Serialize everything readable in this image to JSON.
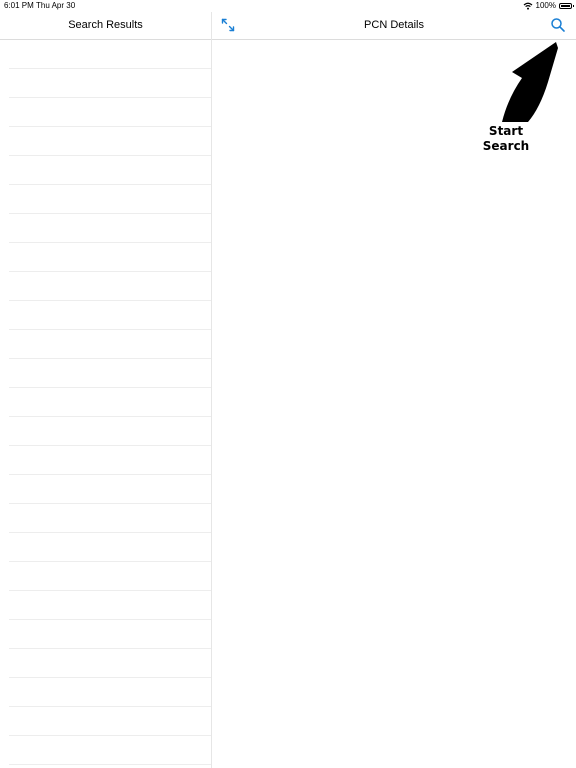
{
  "status_bar": {
    "time": "6:01 PM",
    "date": "Thu Apr 30",
    "battery": "100%",
    "battery_level": 1.0
  },
  "master": {
    "title": "Search Results",
    "row_count": 25
  },
  "detail": {
    "title": "PCN Details",
    "hint_line1": "Start",
    "hint_line2": "Search"
  },
  "colors": {
    "accent": "#1a7fd4",
    "separator": "#ededed"
  },
  "icons": {
    "expand": "expand-arrows-icon",
    "search": "magnifier-icon",
    "wifi": "wifi-icon",
    "battery": "battery-icon",
    "hint": "curved-arrow-icon"
  }
}
